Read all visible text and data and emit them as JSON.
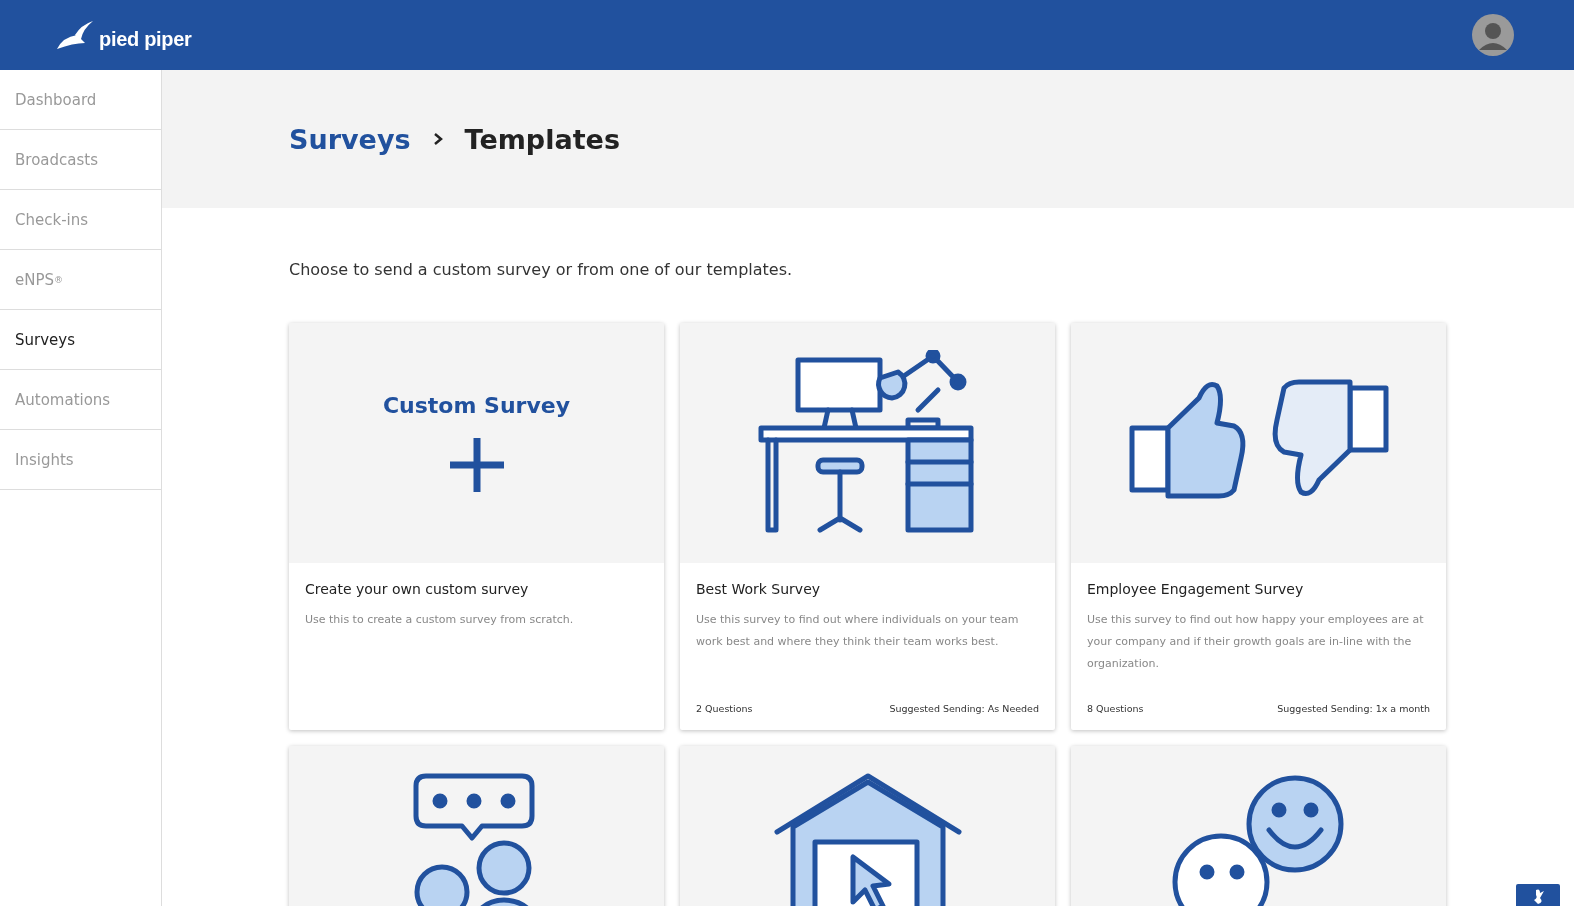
{
  "header": {
    "logo_text": "pied piper"
  },
  "sidebar": {
    "items": [
      {
        "label": "Dashboard",
        "selected": false
      },
      {
        "label": "Broadcasts",
        "selected": false
      },
      {
        "label": "Check-ins",
        "selected": false
      },
      {
        "label": "eNPS",
        "sup": "®",
        "selected": false
      },
      {
        "label": "Surveys",
        "selected": true
      },
      {
        "label": "Automations",
        "selected": false
      },
      {
        "label": "Insights",
        "selected": false
      }
    ]
  },
  "breadcrumb": [
    {
      "label": "Surveys",
      "kind": "link"
    },
    {
      "label": "Templates",
      "kind": "current"
    }
  ],
  "intro": "Choose to send a custom survey or from one of our templates.",
  "cards": [
    {
      "kind": "custom",
      "heading": "Custom Survey",
      "title": "Create your own custom survey",
      "description": "Use this to create a custom survey from scratch."
    },
    {
      "kind": "desk",
      "title": "Best Work Survey",
      "description": "Use this survey to find out where individuals on your team work best and where they think their team works best.",
      "questions": "2 Questions",
      "sending": "Suggested Sending: As Needed"
    },
    {
      "kind": "thumbs",
      "title": "Employee Engagement Survey",
      "description": "Use this survey to find out how happy your employees are at your company and if their growth goals are in-line with the organization.",
      "questions": "8 Questions",
      "sending": "Suggested Sending: 1x a month"
    },
    {
      "kind": "chat"
    },
    {
      "kind": "house"
    },
    {
      "kind": "smileys"
    }
  ]
}
